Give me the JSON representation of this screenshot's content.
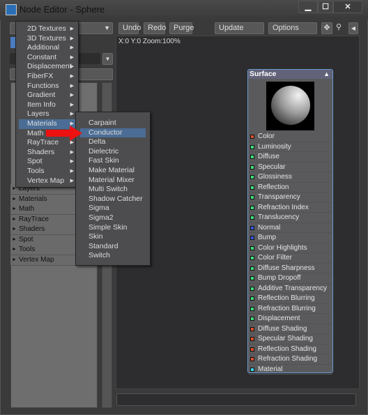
{
  "window": {
    "title": "Node Editor - Sphere",
    "controls": [
      "▁",
      "☐",
      "✕"
    ]
  },
  "toolbar": {
    "undo": "Undo",
    "redo": "Redo",
    "purge": "Purge",
    "update": "Update",
    "options": "Options",
    "icons": [
      "move-icon",
      "zoom-icon",
      "collapse-left-icon"
    ]
  },
  "canvas": {
    "coords": "X:0 Y:0 Zoom:100%"
  },
  "left_list": {
    "items": [
      "Layers",
      "Materials",
      "Math",
      "RayTrace",
      "Shaders",
      "Spot",
      "Tools",
      "Vertex Map"
    ]
  },
  "menu": {
    "items": [
      "2D Textures",
      "3D Textures",
      "Additional",
      "Constant",
      "Displacement",
      "FiberFX",
      "Functions",
      "Gradient",
      "Item Info",
      "Layers",
      "Materials",
      "Math",
      "RayTrace",
      "Shaders",
      "Spot",
      "Tools",
      "Vertex Map"
    ],
    "selected": "Materials"
  },
  "submenu": {
    "items": [
      "Carpaint",
      "Conductor",
      "Delta",
      "Dielectric",
      "Fast Skin",
      "Make Material",
      "Material Mixer",
      "Multi Switch",
      "Shadow Catcher",
      "Sigma",
      "Sigma2",
      "Simple Skin",
      "Skin",
      "Standard",
      "Switch"
    ],
    "selected": "Conductor"
  },
  "colors": {
    "red": "#e0502a",
    "green": "#3ee07a",
    "blue": "#3355dd",
    "cyan": "#40d8f0",
    "highlight": "#4b6d95",
    "arrow": "#ee1111"
  },
  "node": {
    "title": "Surface",
    "inputs": [
      {
        "label": "Color",
        "type": "red"
      },
      {
        "label": "Luminosity",
        "type": "green"
      },
      {
        "label": "Diffuse",
        "type": "green"
      },
      {
        "label": "Specular",
        "type": "green"
      },
      {
        "label": "Glossiness",
        "type": "green"
      },
      {
        "label": "Reflection",
        "type": "green"
      },
      {
        "label": "Transparency",
        "type": "green"
      },
      {
        "label": "Refraction Index",
        "type": "green"
      },
      {
        "label": "Translucency",
        "type": "green"
      },
      {
        "label": "Normal",
        "type": "blue"
      },
      {
        "label": "Bump",
        "type": "blue"
      },
      {
        "label": "Color Highlights",
        "type": "green"
      },
      {
        "label": "Color Filter",
        "type": "green"
      },
      {
        "label": "Diffuse Sharpness",
        "type": "green"
      },
      {
        "label": "Bump Dropoff",
        "type": "green"
      },
      {
        "label": "Additive Transparency",
        "type": "green"
      },
      {
        "label": "Reflection Blurring",
        "type": "green"
      },
      {
        "label": "Refraction Blurring",
        "type": "green"
      },
      {
        "label": "Displacement",
        "type": "green"
      },
      {
        "label": "Diffuse Shading",
        "type": "red"
      },
      {
        "label": "Specular Shading",
        "type": "red"
      },
      {
        "label": "Reflection Shading",
        "type": "red"
      },
      {
        "label": "Refraction Shading",
        "type": "red"
      },
      {
        "label": "Material",
        "type": "cyan"
      }
    ]
  }
}
